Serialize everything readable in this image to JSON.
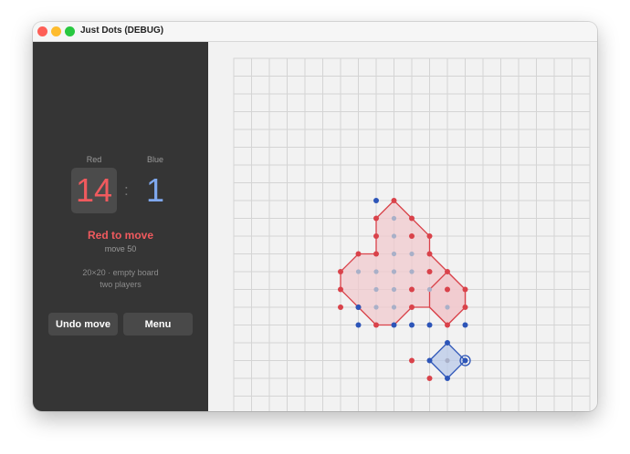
{
  "window": {
    "title": "Just Dots (DEBUG)"
  },
  "scores": {
    "red_label": "Red",
    "blue_label": "Blue",
    "red_score": "14",
    "blue_score": "1",
    "separator": ":"
  },
  "status": {
    "turn": "Red to move",
    "move": "move 50",
    "board_info": "20×20 · empty board",
    "players": "two players"
  },
  "buttons": {
    "undo": "Undo move",
    "menu": "Menu"
  },
  "colors": {
    "red": "#d9424a",
    "blue": "#2d55b8",
    "red_fill": "#f0c9cd",
    "blue_fill": "#b9c9e8",
    "grid": "#d4d4d4",
    "captured": "#a9b0c8"
  },
  "board": {
    "size": 20,
    "red_dots": [
      [
        9,
        8
      ],
      [
        8,
        9
      ],
      [
        10,
        9
      ],
      [
        8,
        10
      ],
      [
        10,
        10
      ],
      [
        11,
        10
      ],
      [
        7,
        11
      ],
      [
        8,
        11
      ],
      [
        11,
        11
      ],
      [
        6,
        12
      ],
      [
        11,
        12
      ],
      [
        12,
        12
      ],
      [
        6,
        13
      ],
      [
        10,
        13
      ],
      [
        12,
        13
      ],
      [
        13,
        13
      ],
      [
        6,
        14
      ],
      [
        7,
        14
      ],
      [
        10,
        14
      ],
      [
        13,
        14
      ],
      [
        8,
        15
      ],
      [
        12,
        15
      ],
      [
        10,
        17
      ],
      [
        11,
        18
      ]
    ],
    "blue_dots": [
      [
        8,
        8
      ],
      [
        7,
        14
      ],
      [
        7,
        15
      ],
      [
        9,
        15
      ],
      [
        10,
        15
      ],
      [
        11,
        15
      ],
      [
        13,
        15
      ],
      [
        12,
        16
      ],
      [
        11,
        17
      ],
      [
        13,
        17
      ],
      [
        12,
        18
      ]
    ],
    "captured_dots": [
      [
        9,
        9
      ],
      [
        9,
        10
      ],
      [
        9,
        11
      ],
      [
        10,
        11
      ],
      [
        7,
        12
      ],
      [
        8,
        12
      ],
      [
        9,
        12
      ],
      [
        10,
        12
      ],
      [
        8,
        13
      ],
      [
        9,
        13
      ],
      [
        11,
        13
      ],
      [
        8,
        14
      ],
      [
        9,
        14
      ],
      [
        12,
        14
      ],
      [
        12,
        17
      ]
    ],
    "last_move": [
      13,
      17
    ],
    "red_areas": [
      [
        [
          9,
          8
        ],
        [
          10,
          9
        ],
        [
          11,
          10
        ],
        [
          11,
          11
        ],
        [
          12,
          12
        ],
        [
          13,
          13
        ],
        [
          13,
          14
        ],
        [
          12,
          15
        ],
        [
          11,
          14
        ],
        [
          10,
          14
        ],
        [
          9,
          15
        ],
        [
          8,
          15
        ],
        [
          7,
          14
        ],
        [
          6,
          13
        ],
        [
          6,
          12
        ],
        [
          7,
          11
        ],
        [
          8,
          11
        ],
        [
          8,
          10
        ],
        [
          8,
          9
        ]
      ],
      [
        [
          12,
          12
        ],
        [
          13,
          13
        ],
        [
          13,
          14
        ],
        [
          12,
          15
        ],
        [
          11,
          14
        ],
        [
          11,
          13
        ]
      ]
    ],
    "blue_areas": [
      [
        [
          12,
          16
        ],
        [
          13,
          17
        ],
        [
          12,
          18
        ],
        [
          11,
          17
        ]
      ]
    ]
  }
}
